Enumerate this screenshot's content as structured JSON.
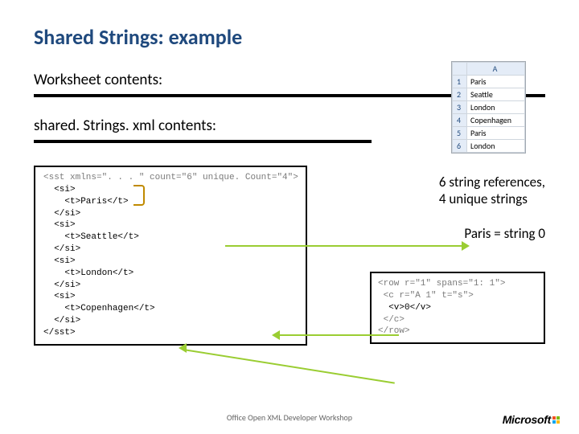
{
  "title": "Shared Strings: example",
  "sub1": "Worksheet contents:",
  "sub2": "shared. Strings. xml contents:",
  "excel": {
    "colhead": "A",
    "rows": [
      "Paris",
      "Seattle",
      "London",
      "Copenhagen",
      "Paris",
      "London"
    ]
  },
  "code": {
    "l1": "<sst xmlns=\". . . \" count=\"6\" unique. Count=\"4\">",
    "l2": "  <si>",
    "l3": "    <t>Paris</t>",
    "l4": "  </si>",
    "l5": "  <si>",
    "l6": "    <t>Seattle</t>",
    "l7": "  </si>",
    "l8": "  <si>",
    "l9": "    <t>London</t>",
    "l10": "  </si>",
    "l11": "  <si>",
    "l12": "    <t>Copenhagen</t>",
    "l13": "  </si>",
    "l14": "</sst>"
  },
  "note1a": "6 string references,",
  "note1b": "4 unique strings",
  "note2": "Paris = string 0",
  "rowcode": {
    "l1": "<row r=\"1\" spans=\"1: 1\">",
    "l2": " <c r=\"A 1\" t=\"s\">",
    "l3": "  <v>0</v>",
    "l4": " </c>",
    "l5": "</row>"
  },
  "footer": "Office Open XML Developer Workshop",
  "logo": "Microsoft"
}
